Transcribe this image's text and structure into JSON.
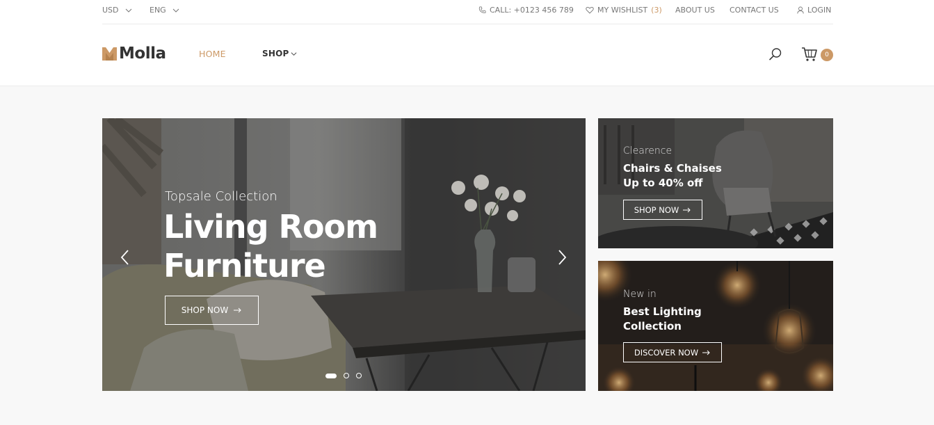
{
  "topbar": {
    "currency": "USD",
    "language": "ENG",
    "call": "CALL: +0123 456 789",
    "wishlist_label": "MY WISHLIST",
    "wishlist_count": "(3)",
    "about": "ABOUT US",
    "contact": "CONTACT US",
    "login": "LOGIN"
  },
  "header": {
    "logo": "Molla",
    "nav": {
      "home": "HOME",
      "shop": "SHOP"
    },
    "cart_count": "0"
  },
  "hero": {
    "subtitle": "Topsale Collection",
    "title_line1": "Living Room",
    "title_line2": "Furniture",
    "button": "SHOP NOW",
    "slides": 3,
    "active_slide": 1
  },
  "banners": [
    {
      "subtitle": "Clearence",
      "title_line1": "Chairs & Chaises",
      "title_line2": "Up to 40% off",
      "button": "SHOP NOW"
    },
    {
      "subtitle": "New in",
      "title_line1": "Best Lighting",
      "title_line2": "Collection",
      "button": "DISCOVER NOW"
    }
  ],
  "colors": {
    "accent": "#cc9966",
    "page_bg": "#f8f8f8"
  },
  "icons": {
    "phone": "phone-icon",
    "wishlist": "heart-icon",
    "login": "user-icon",
    "search": "search-icon",
    "cart": "cart-icon"
  }
}
